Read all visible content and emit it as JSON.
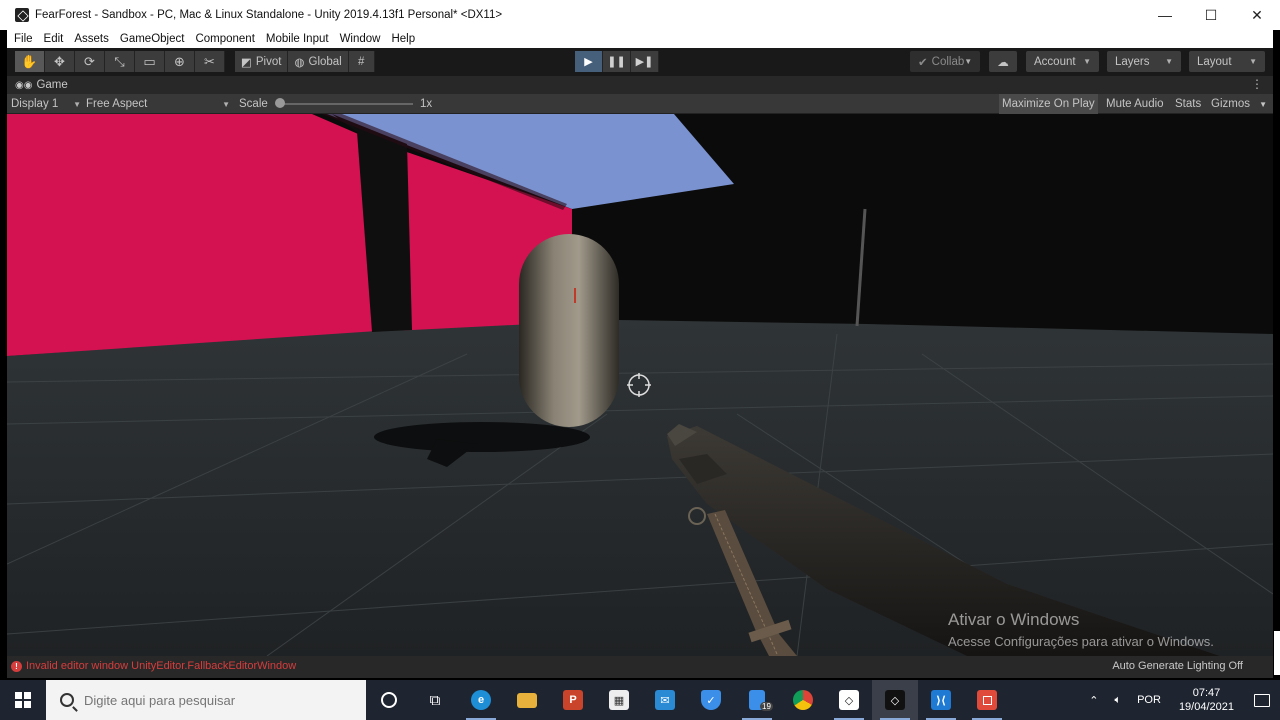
{
  "window": {
    "title": "FearForest - Sandbox - PC, Mac & Linux Standalone - Unity 2019.4.13f1 Personal* <DX11>",
    "minimize_glyph": "—",
    "maximize_glyph": "☐",
    "close_glyph": "✕"
  },
  "menu": [
    "File",
    "Edit",
    "Assets",
    "GameObject",
    "Component",
    "Mobile Input",
    "Window",
    "Help"
  ],
  "toolbar": {
    "tools": [
      "hand-icon",
      "move-icon",
      "rotate-icon",
      "scale-icon",
      "rect-icon",
      "transform-icon",
      "custom-tool-icon"
    ],
    "pivot_label": "Pivot",
    "global_label": "Global",
    "collab_label": "Collab",
    "account_label": "Account",
    "layers_label": "Layers",
    "layout_label": "Layout"
  },
  "game_tab": {
    "label": "Game",
    "display": "Display 1",
    "aspect": "Free Aspect",
    "scale_label": "Scale",
    "scale_value": "1x",
    "maximize_on_play": "Maximize On Play",
    "mute_audio": "Mute Audio",
    "stats": "Stats",
    "gizmos": "Gizmos"
  },
  "watermark": {
    "line1": "Ativar o Windows",
    "line2": "Acesse Configurações para ativar o Windows."
  },
  "status": {
    "error": "Invalid editor window UnityEditor.FallbackEditorWindow",
    "right": "Auto Generate Lighting Off"
  },
  "taskbar": {
    "search_placeholder": "Digite aqui para pesquisar",
    "badge": "19",
    "language": "POR",
    "time": "07:47",
    "date": "19/04/2021"
  },
  "colors": {
    "play_active": "#46607c",
    "wall_red": "#d41252",
    "sky": "#7a92d0",
    "floor": "#26292b"
  }
}
